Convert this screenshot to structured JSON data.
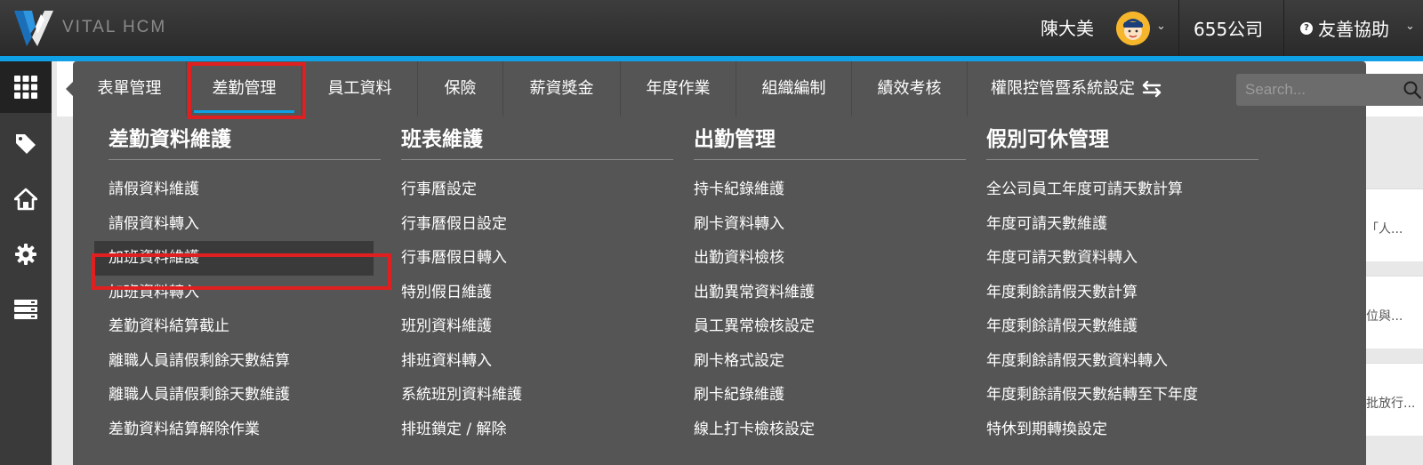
{
  "topbar": {
    "brand": "VITAL HCM",
    "user_name": "陳大美",
    "company": "655公司",
    "help_label": "友善協助",
    "colors": {
      "accent": "#0ea1e6",
      "bar": "#333333",
      "highlight": "#e02020"
    }
  },
  "rail": {
    "icons": [
      "grid-icon",
      "tag-icon",
      "home-icon",
      "gear-icon",
      "server-icon"
    ]
  },
  "menu": {
    "tabs": [
      {
        "label": "表單管理"
      },
      {
        "label": "差勤管理"
      },
      {
        "label": "員工資料"
      },
      {
        "label": "保險"
      },
      {
        "label": "薪資獎金"
      },
      {
        "label": "年度作業"
      },
      {
        "label": "組織編制"
      },
      {
        "label": "績效考核"
      },
      {
        "label": "權限控管暨系統設定"
      }
    ],
    "active_tab": "差勤管理",
    "search_placeholder": "Search...",
    "columns": [
      {
        "title": "差勤資料維護",
        "items": [
          "請假資料維護",
          "請假資料轉入",
          "加班資料維護",
          "加班資料轉入",
          "差勤資料結算截止",
          "離職人員請假剩餘天數結算",
          "離職人員請假剩餘天數維護",
          "差勤資料結算解除作業"
        ]
      },
      {
        "title": "班表維護",
        "items": [
          "行事曆設定",
          "行事曆假日設定",
          "行事曆假日轉入",
          "特別假日維護",
          "班別資料維護",
          "排班資料轉入",
          "系統班別資料維護",
          "排班鎖定 / 解除"
        ]
      },
      {
        "title": "出勤管理",
        "items": [
          "持卡紀錄維護",
          "刷卡資料轉入",
          "出勤資料檢核",
          "出勤異常資料維護",
          "員工異常檢核設定",
          "刷卡格式設定",
          "刷卡紀錄維護",
          "線上打卡檢核設定"
        ]
      },
      {
        "title": "假別可休管理",
        "items": [
          "全公司員工年度可請天數計算",
          "年度可請天數維護",
          "年度可請天數資料轉入",
          "年度剩餘請假天數計算",
          "年度剩餘請假天數維護",
          "年度剩餘請假天數資料轉入",
          "年度剩餘請假天數結轉至下年度",
          "特休到期轉換設定"
        ]
      }
    ]
  },
  "background": {
    "cards": [
      "「人...",
      "位與...",
      "批放行..."
    ]
  }
}
